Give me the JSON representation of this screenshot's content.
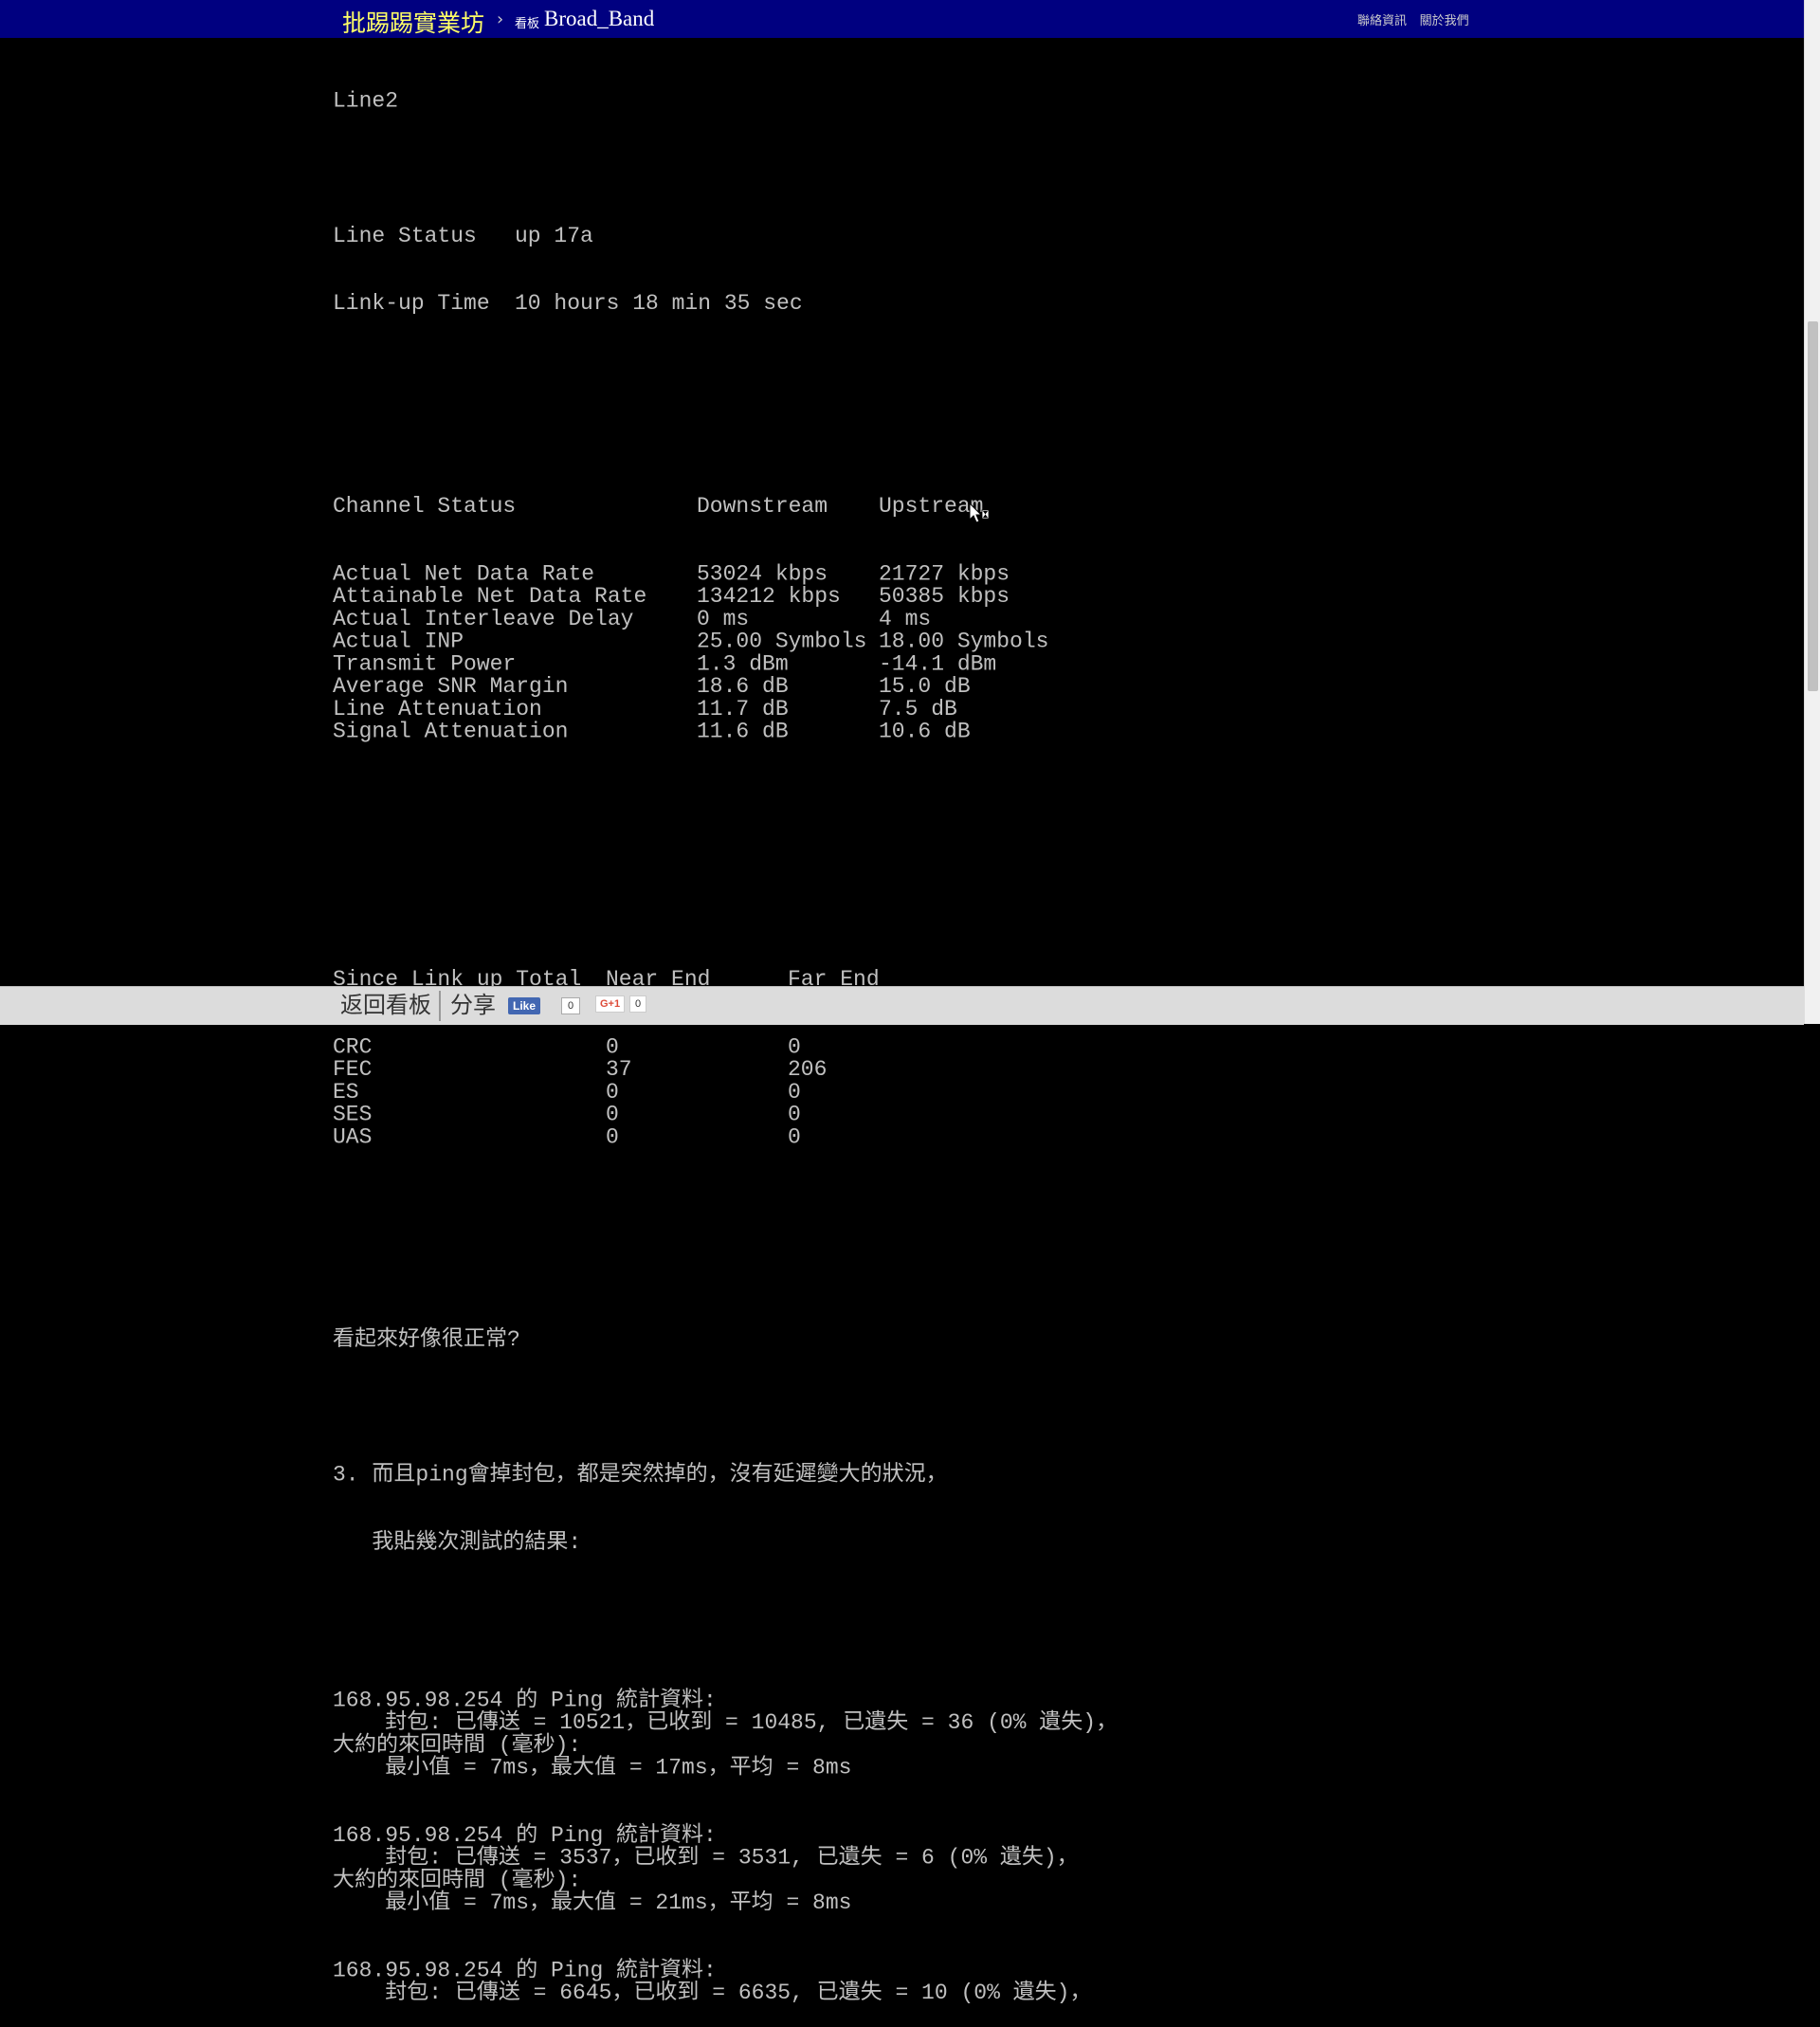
{
  "header": {
    "site_name": "批踢踢實業坊",
    "breadcrumb_sep": "›",
    "board_tag": "看板",
    "board_name": "Broad_Band",
    "links": [
      "聯絡資訊",
      "關於我們"
    ]
  },
  "article": {
    "line_name": "Line2",
    "line_status": {
      "label": "Line Status",
      "value": "up 17a"
    },
    "link_up_time": {
      "label": "Link-up Time",
      "value": "10 hours 18 min 35 sec"
    },
    "channel_header": [
      "Channel Status",
      "Downstream",
      "Upstream"
    ],
    "channel_rows": [
      [
        "Actual Net Data Rate",
        "53024 kbps",
        "21727 kbps"
      ],
      [
        "Attainable Net Data Rate",
        "134212 kbps",
        "50385 kbps"
      ],
      [
        "Actual Interleave Delay",
        "0 ms",
        "4 ms"
      ],
      [
        "Actual INP",
        "25.00 Symbols",
        "18.00 Symbols"
      ],
      [
        "Transmit Power",
        "1.3 dBm",
        "-14.1 dBm"
      ],
      [
        "Average SNR Margin",
        "18.6 dB",
        "15.0 dB"
      ],
      [
        "Line Attenuation",
        "11.7 dB",
        "7.5 dB"
      ],
      [
        "Signal Attenuation",
        "11.6 dB",
        "10.6 dB"
      ]
    ],
    "error_header": [
      "Since Link up Total",
      "Near End",
      "Far End"
    ],
    "error_rows": [
      [
        "CRC",
        "0",
        "0"
      ],
      [
        "FEC",
        "37",
        "206"
      ],
      [
        "ES",
        "0",
        "0"
      ],
      [
        "SES",
        "0",
        "0"
      ],
      [
        "UAS",
        "0",
        "0"
      ]
    ],
    "comment": "看起來好像很正常?",
    "point3_line1": "3. 而且ping會掉封包，都是突然掉的，沒有延遲變大的狀況，",
    "point3_line2": "   我貼幾次測試的結果:",
    "ping_results": [
      {
        "title": "168.95.98.254 的 Ping 統計資料:",
        "packets": "    封包: 已傳送 = 10521，已收到 = 10485, 已遺失 = 36 (0% 遺失)，",
        "rtt_label": "大約的來回時間 (毫秒):",
        "rtt": "    最小值 = 7ms，最大值 = 17ms，平均 = 8ms"
      },
      {
        "title": "168.95.98.254 的 Ping 統計資料:",
        "packets": "    封包: 已傳送 = 3537，已收到 = 3531, 已遺失 = 6 (0% 遺失)，",
        "rtt_label": "大約的來回時間 (毫秒):",
        "rtt": "    最小值 = 7ms，最大值 = 21ms，平均 = 8ms"
      },
      {
        "title": "168.95.98.254 的 Ping 統計資料:",
        "packets": "    封包: 已傳送 = 6645，已收到 = 6635, 已遺失 = 10 (0% 遺失)，"
      }
    ]
  },
  "footer": {
    "back_label": "返回看板",
    "share_label": "分享",
    "fb_like": "Like",
    "fb_count": "0",
    "gplus_label": "G+1",
    "gplus_count": "0"
  },
  "colors": {
    "topbar_bg": "#000080",
    "brand": "#ffff66",
    "text": "#c0c0c0",
    "bottombar_bg": "#dcdcdc"
  },
  "icons": [
    "breadcrumb-chevron-icon",
    "facebook-like-icon",
    "google-plus-icon",
    "mouse-cursor-icon"
  ]
}
